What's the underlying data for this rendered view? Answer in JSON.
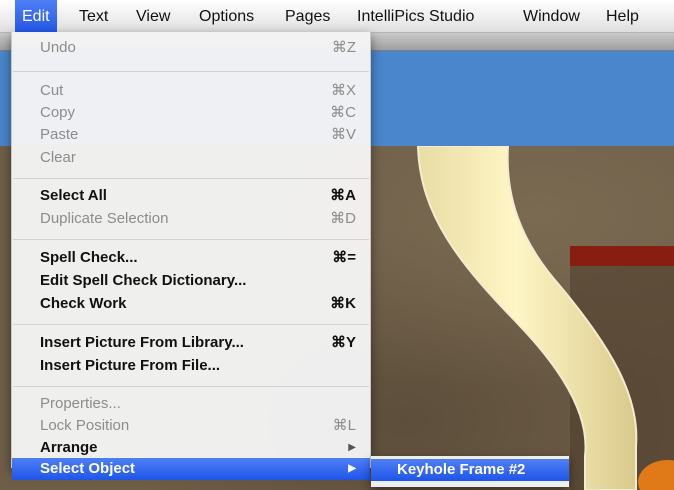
{
  "menubar": {
    "items": [
      "Edit",
      "Text",
      "View",
      "Options",
      "Pages",
      "IntelliPics Studio",
      "Window",
      "Help"
    ],
    "active": "Edit"
  },
  "edit_menu": {
    "undo": {
      "label": "Undo",
      "shortcut": "⌘Z"
    },
    "cut": {
      "label": "Cut",
      "shortcut": "⌘X"
    },
    "copy": {
      "label": "Copy",
      "shortcut": "⌘C"
    },
    "paste": {
      "label": "Paste",
      "shortcut": "⌘V"
    },
    "clear": {
      "label": "Clear"
    },
    "select_all": {
      "label": "Select All",
      "shortcut": "⌘A"
    },
    "duplicate": {
      "label": "Duplicate Selection",
      "shortcut": "⌘D"
    },
    "spell_check": {
      "label": "Spell Check...",
      "shortcut": "⌘="
    },
    "edit_dict": {
      "label": "Edit Spell Check Dictionary..."
    },
    "check_work": {
      "label": "Check Work",
      "shortcut": "⌘K"
    },
    "insert_lib": {
      "label": "Insert Picture From Library...",
      "shortcut": "⌘Y"
    },
    "insert_file": {
      "label": "Insert Picture From File..."
    },
    "properties": {
      "label": "Properties..."
    },
    "lock": {
      "label": "Lock Position",
      "shortcut": "⌘L"
    },
    "arrange": {
      "label": "Arrange",
      "arrow": "▶"
    },
    "select_obj": {
      "label": "Select Object",
      "arrow": "▶"
    }
  },
  "submenu": {
    "items": [
      "Keyhole Frame #2"
    ]
  },
  "colors": {
    "highlight": "#2356e6",
    "header_blue": "#4a86cc",
    "disabled_text": "#8c8c8c"
  }
}
